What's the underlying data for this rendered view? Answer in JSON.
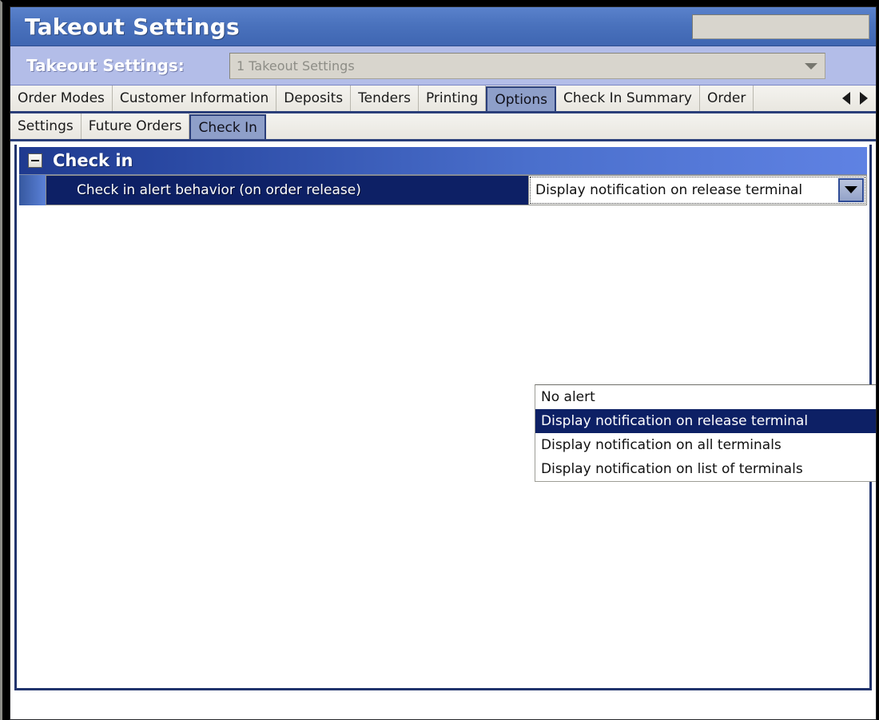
{
  "window": {
    "title": "Takeout Settings"
  },
  "selector": {
    "label": "Takeout Settings:",
    "value": "1 Takeout Settings",
    "arrow_icon": "chevron-down-icon"
  },
  "title_field": {
    "value": ""
  },
  "main_tabs": {
    "items": [
      {
        "label": "Order Modes",
        "active": false
      },
      {
        "label": "Customer Information",
        "active": false
      },
      {
        "label": "Deposits",
        "active": false
      },
      {
        "label": "Tenders",
        "active": false
      },
      {
        "label": "Printing",
        "active": false
      },
      {
        "label": "Options",
        "active": true
      },
      {
        "label": "Check In Summary",
        "active": false
      },
      {
        "label": "Order",
        "active": false
      }
    ],
    "scroll_left_icon": "arrow-left-icon",
    "scroll_right_icon": "arrow-right-icon"
  },
  "sub_tabs": {
    "items": [
      {
        "label": "Settings",
        "active": false
      },
      {
        "label": "Future Orders",
        "active": false
      },
      {
        "label": "Check In",
        "active": true
      }
    ]
  },
  "group": {
    "title": "Check in",
    "expander_icon": "collapse-minus-icon",
    "expanded": true
  },
  "setting_row": {
    "label": "Check in alert behavior (on order release)",
    "value": "Display notification on release terminal",
    "dropdown_icon": "dropdown-arrow-icon"
  },
  "dropdown": {
    "open": true,
    "options": [
      {
        "label": "No alert",
        "selected": false
      },
      {
        "label": "Display notification on release terminal",
        "selected": true
      },
      {
        "label": "Display notification on all terminals",
        "selected": false
      },
      {
        "label": "Display notification on list of terminals",
        "selected": false
      }
    ]
  },
  "colors": {
    "title_bar_blue": "#4a72bd",
    "selector_bar_blue": "#b3bde8",
    "group_header_start": "#1f3a8f",
    "group_header_end": "#5f82e3",
    "selection_navy": "#0d2065",
    "content_border": "#21346d",
    "active_tab": "#8e9fc9"
  }
}
